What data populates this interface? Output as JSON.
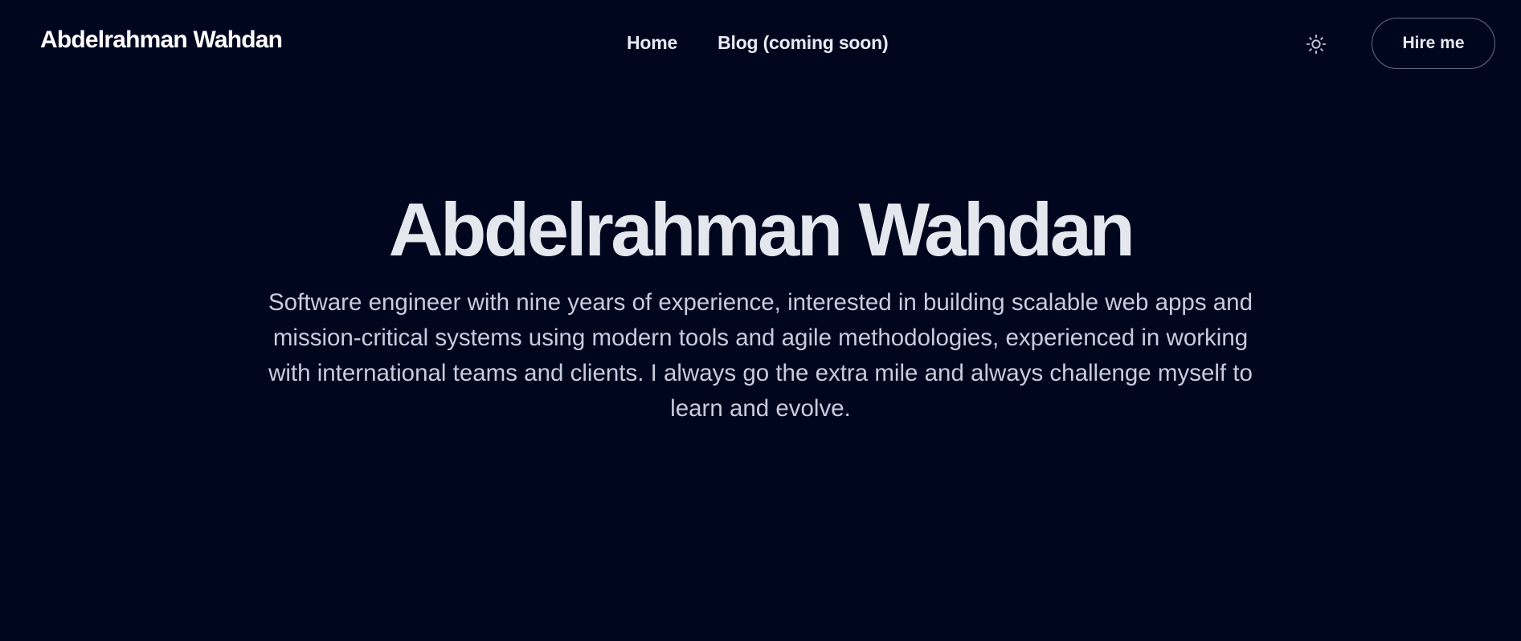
{
  "header": {
    "brand": "Abdelrahman Wahdan",
    "nav": [
      {
        "label": "Home"
      },
      {
        "label": "Blog (coming soon)"
      }
    ],
    "theme_toggle_icon": "sun-icon",
    "hire_label": "Hire me"
  },
  "hero": {
    "title": "Abdelrahman Wahdan",
    "bio": "Software engineer with nine years of experience, interested in building scalable web apps and mission-critical systems using modern tools and agile methodologies, experienced in working with international teams and clients. I always go the extra mile and always challenge myself to learn and evolve."
  },
  "colors": {
    "background": "#01061f",
    "text_primary": "#ffffff",
    "text_secondary": "#c8ccdd",
    "button_border": "#6a6e86"
  }
}
